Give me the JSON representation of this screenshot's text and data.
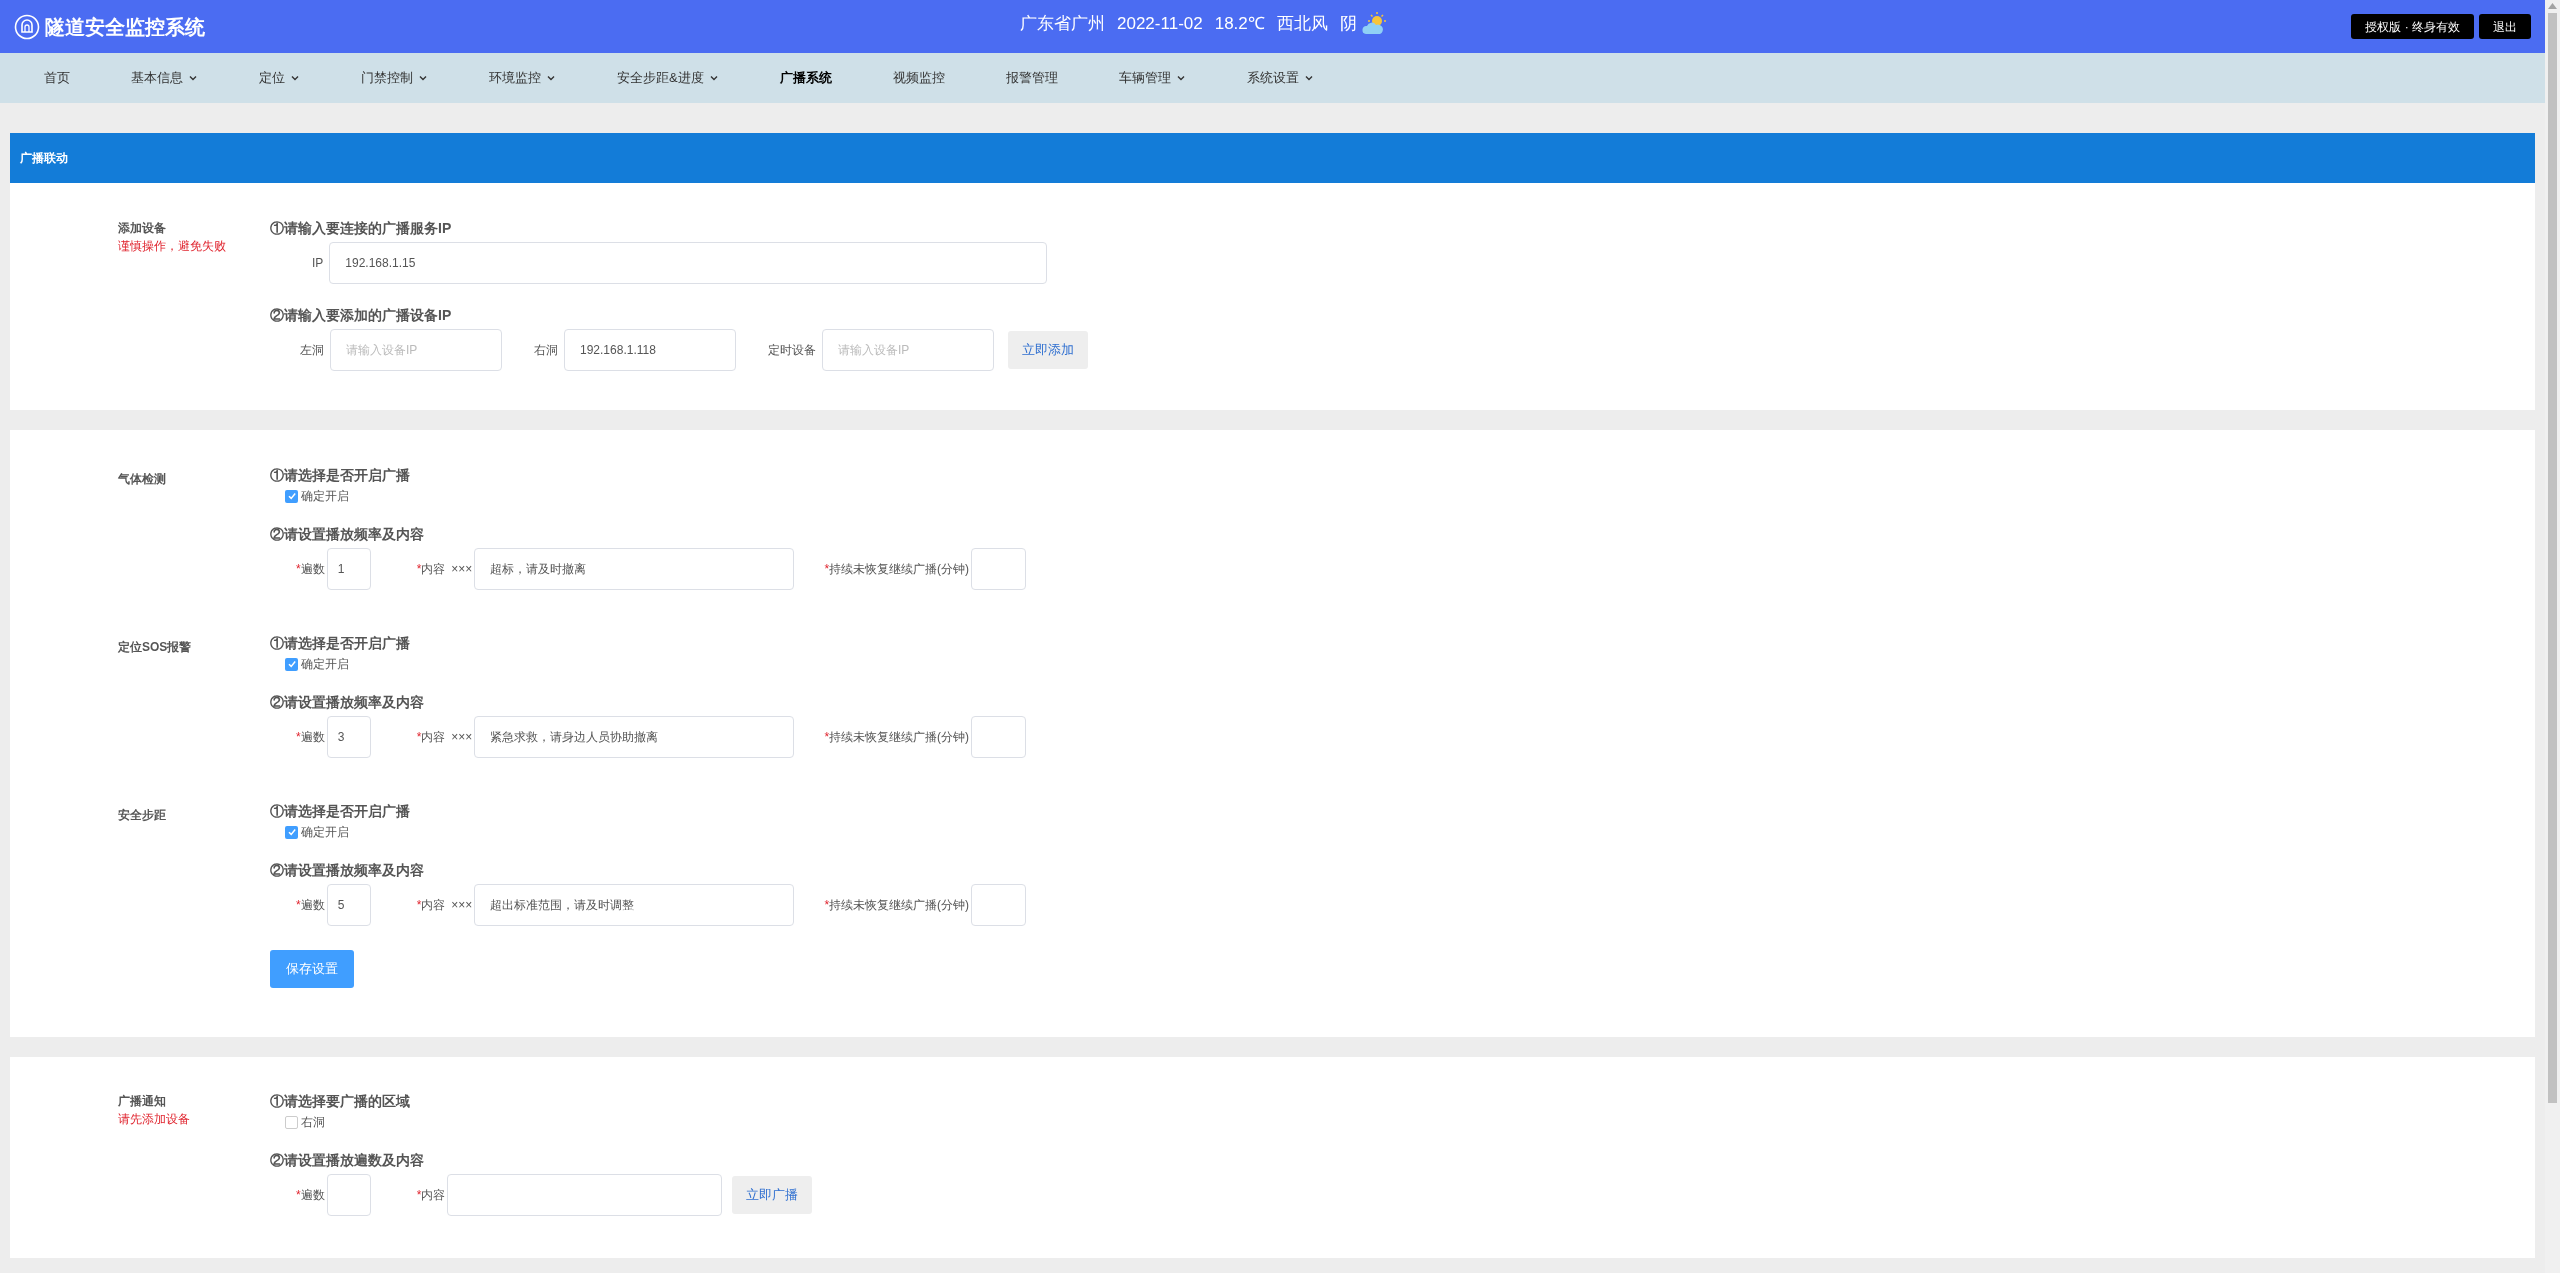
{
  "header": {
    "title": "隧道安全监控系统",
    "location": "广东省广州",
    "date": "2022-11-02",
    "temperature": "18.2℃",
    "wind": "西北风",
    "weather": "阴",
    "license_button": "授权版 · 终身有效",
    "logout_button": "退出"
  },
  "nav": [
    {
      "label": "首页",
      "dropdown": false,
      "selected": false
    },
    {
      "label": "基本信息",
      "dropdown": true,
      "selected": false
    },
    {
      "label": "定位",
      "dropdown": true,
      "selected": false
    },
    {
      "label": "门禁控制",
      "dropdown": true,
      "selected": false
    },
    {
      "label": "环境监控",
      "dropdown": true,
      "selected": false
    },
    {
      "label": "安全步距&进度",
      "dropdown": true,
      "selected": false
    },
    {
      "label": "广播系统",
      "dropdown": false,
      "selected": true
    },
    {
      "label": "视频监控",
      "dropdown": false,
      "selected": false
    },
    {
      "label": "报警管理",
      "dropdown": false,
      "selected": false
    },
    {
      "label": "车辆管理",
      "dropdown": true,
      "selected": false
    },
    {
      "label": "系统设置",
      "dropdown": true,
      "selected": false
    }
  ],
  "panel_title": "广播联动",
  "add_device": {
    "label": "添加设备",
    "warning": "谨慎操作，避免失败",
    "step1": "①请输入要连接的广播服务IP",
    "ip_label": "IP",
    "ip_value": "192.168.1.15",
    "step2": "②请输入要添加的广播设备IP",
    "fields": [
      {
        "label": "左洞",
        "placeholder": "请输入设备IP"
      },
      {
        "label": "右洞",
        "value": "192.168.1.118"
      },
      {
        "label": "定时设备",
        "placeholder": "请输入设备IP"
      }
    ],
    "add_button": "立即添加"
  },
  "alarms": [
    {
      "label": "气体检测",
      "step1": "①请选择是否开启广播",
      "enable_label": "确定开启",
      "checked": true,
      "step2": "②请设置播放频率及内容",
      "times": {
        "mark": "*",
        "label": "遍数",
        "value": "1"
      },
      "content": {
        "mark": "*",
        "label": "内容",
        "prefix": "×××",
        "value": "超标，请及时撤离"
      },
      "duration": {
        "mark": "*",
        "label": "持续未恢复继续广播(分钟)"
      }
    },
    {
      "label": "定位SOS报警",
      "step1": "①请选择是否开启广播",
      "enable_label": "确定开启",
      "checked": true,
      "step2": "②请设置播放频率及内容",
      "times": {
        "mark": "*",
        "label": "遍数",
        "value": "3"
      },
      "content": {
        "mark": "*",
        "label": "内容",
        "prefix": "×××",
        "value": "紧急求救，请身边人员协助撤离"
      },
      "duration": {
        "mark": "*",
        "label": "持续未恢复继续广播(分钟)"
      }
    },
    {
      "label": "安全步距",
      "step1": "①请选择是否开启广播",
      "enable_label": "确定开启",
      "checked": true,
      "step2": "②请设置播放频率及内容",
      "times": {
        "mark": "*",
        "label": "遍数",
        "value": "5"
      },
      "content": {
        "mark": "*",
        "label": "内容",
        "prefix": "×××",
        "value": "超出标准范围，请及时调整"
      },
      "duration": {
        "mark": "*",
        "label": "持续未恢复继续广播(分钟)"
      }
    }
  ],
  "save_button": "保存设置",
  "notify": {
    "label": "广播通知",
    "warning": "请先添加设备",
    "step1": "①请选择要广播的区域",
    "area": {
      "label": "右洞",
      "checked": false
    },
    "step2": "②请设置播放遍数及内容",
    "times": {
      "mark": "*",
      "label": "遍数"
    },
    "content": {
      "mark": "*",
      "label": "内容"
    },
    "broadcast_button": "立即广播"
  }
}
